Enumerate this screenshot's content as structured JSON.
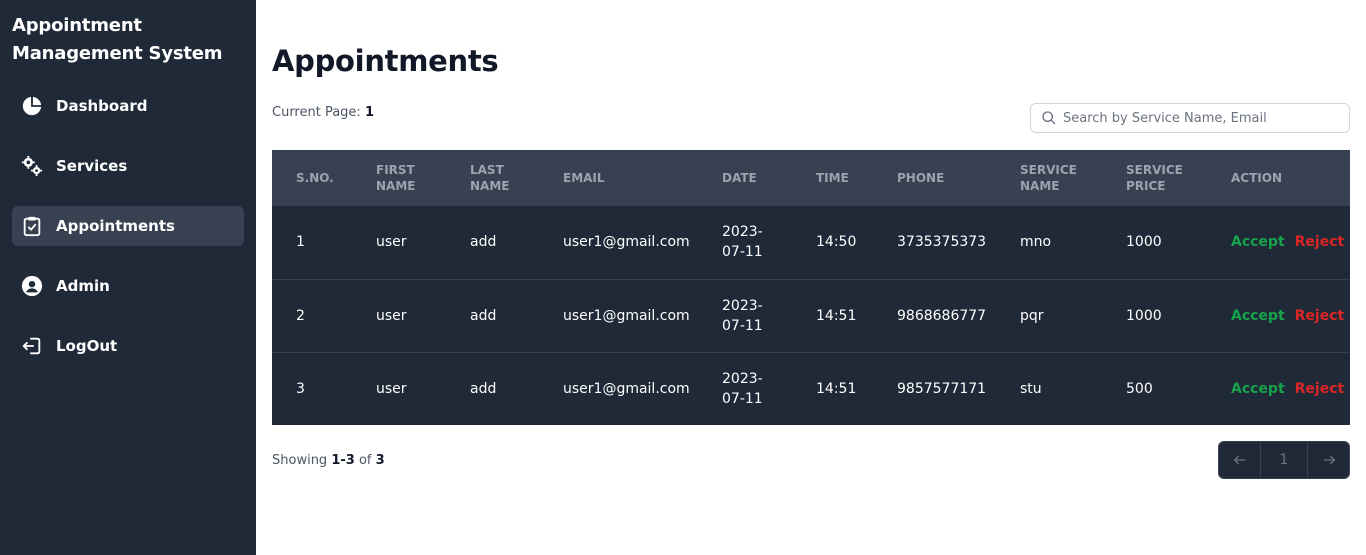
{
  "sidebar": {
    "brand": "Appointment Management System",
    "items": [
      {
        "label": "Dashboard",
        "icon": "pie-chart-icon"
      },
      {
        "label": "Services",
        "icon": "gears-icon"
      },
      {
        "label": "Appointments",
        "icon": "clipboard-check-icon",
        "active": true
      },
      {
        "label": "Admin",
        "icon": "user-circle-icon"
      },
      {
        "label": "LogOut",
        "icon": "logout-icon"
      }
    ]
  },
  "main": {
    "title": "Appointments",
    "current_page_label": "Current Page:",
    "current_page": "1",
    "search_placeholder": "Search by Service Name, Email"
  },
  "table": {
    "headers": [
      "S.NO.",
      "FIRST NAME",
      "LAST NAME",
      "EMAIL",
      "DATE",
      "TIME",
      "PHONE",
      "SERVICE NAME",
      "SERVICE PRICE",
      "ACTION"
    ],
    "rows": [
      {
        "sno": "1",
        "first": "user",
        "last": "add",
        "email": "user1@gmail.com",
        "date": "2023-07-11",
        "time": "14:50",
        "phone": "3735375373",
        "service": "mno",
        "price": "1000"
      },
      {
        "sno": "2",
        "first": "user",
        "last": "add",
        "email": "user1@gmail.com",
        "date": "2023-07-11",
        "time": "14:51",
        "phone": "9868686777",
        "service": "pqr",
        "price": "1000"
      },
      {
        "sno": "3",
        "first": "user",
        "last": "add",
        "email": "user1@gmail.com",
        "date": "2023-07-11",
        "time": "14:51",
        "phone": "9857577171",
        "service": "stu",
        "price": "500"
      }
    ],
    "accept_label": "Accept",
    "reject_label": "Reject"
  },
  "footer": {
    "showing_prefix": "Showing",
    "range": "1-3",
    "of_label": "of",
    "total": "3",
    "page_number": "1"
  },
  "colors": {
    "sidebar_bg": "#1f2937",
    "accept": "#16a34a",
    "reject": "#dc2626"
  }
}
